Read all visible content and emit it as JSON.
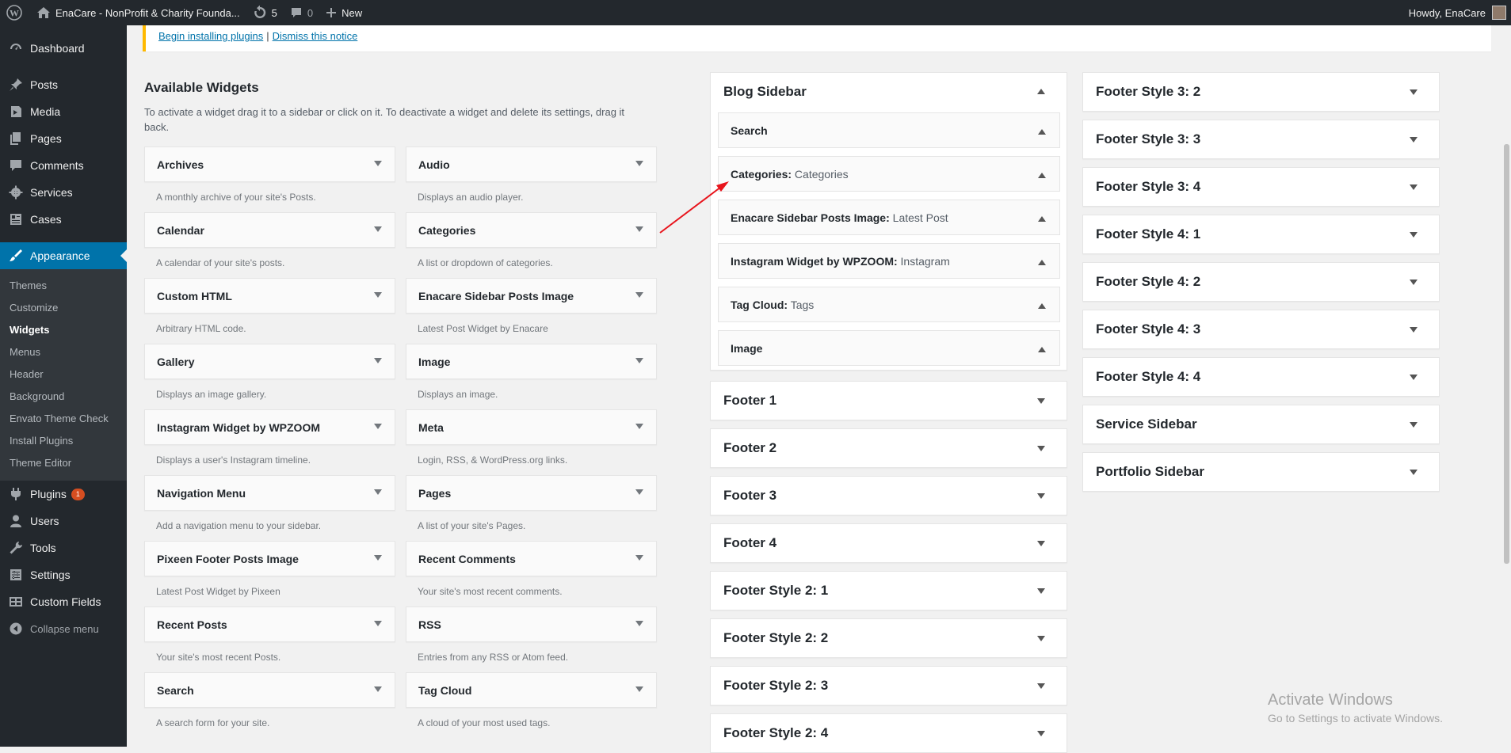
{
  "adminbar": {
    "site_name": "EnaCare - NonProfit & Charity Founda...",
    "updates_count": "5",
    "comments_count": "0",
    "new_label": "New",
    "howdy": "Howdy, EnaCare"
  },
  "menu": {
    "dashboard": "Dashboard",
    "posts": "Posts",
    "media": "Media",
    "pages": "Pages",
    "comments": "Comments",
    "services": "Services",
    "cases": "Cases",
    "appearance": "Appearance",
    "appearance_sub": [
      "Themes",
      "Customize",
      "Widgets",
      "Menus",
      "Header",
      "Background",
      "Envato Theme Check",
      "Install Plugins",
      "Theme Editor"
    ],
    "plugins": "Plugins",
    "plugins_badge": "1",
    "users": "Users",
    "tools": "Tools",
    "settings": "Settings",
    "custom_fields": "Custom Fields",
    "collapse": "Collapse menu"
  },
  "notice": {
    "begin_link": "Begin installing plugins",
    "separator": "|",
    "dismiss_link": "Dismiss this notice"
  },
  "available": {
    "title": "Available Widgets",
    "description": "To activate a widget drag it to a sidebar or click on it. To deactivate a widget and delete its settings, drag it back.",
    "widgets": [
      {
        "title": "Archives",
        "desc": "A monthly archive of your site's Posts."
      },
      {
        "title": "Audio",
        "desc": "Displays an audio player."
      },
      {
        "title": "Calendar",
        "desc": "A calendar of your site's posts."
      },
      {
        "title": "Categories",
        "desc": "A list or dropdown of categories."
      },
      {
        "title": "Custom HTML",
        "desc": "Arbitrary HTML code."
      },
      {
        "title": "Enacare Sidebar Posts Image",
        "desc": "Latest Post Widget by Enacare"
      },
      {
        "title": "Gallery",
        "desc": "Displays an image gallery."
      },
      {
        "title": "Image",
        "desc": "Displays an image."
      },
      {
        "title": "Instagram Widget by WPZOOM",
        "desc": "Displays a user's Instagram timeline."
      },
      {
        "title": "Meta",
        "desc": "Login, RSS, & WordPress.org links."
      },
      {
        "title": "Navigation Menu",
        "desc": "Add a navigation menu to your sidebar."
      },
      {
        "title": "Pages",
        "desc": "A list of your site's Pages."
      },
      {
        "title": "Pixeen Footer Posts Image",
        "desc": "Latest Post Widget by Pixeen"
      },
      {
        "title": "Recent Comments",
        "desc": "Your site's most recent comments."
      },
      {
        "title": "Recent Posts",
        "desc": "Your site's most recent Posts."
      },
      {
        "title": "RSS",
        "desc": "Entries from any RSS or Atom feed."
      },
      {
        "title": "Search",
        "desc": "A search form for your site."
      },
      {
        "title": "Tag Cloud",
        "desc": "A cloud of your most used tags."
      }
    ]
  },
  "blog_sidebar": {
    "title": "Blog Sidebar",
    "widgets": [
      {
        "title": "Search",
        "sub": ""
      },
      {
        "title": "Categories:",
        "sub": " Categories"
      },
      {
        "title": "Enacare Sidebar Posts Image:",
        "sub": " Latest Post"
      },
      {
        "title": "Instagram Widget by WPZOOM:",
        "sub": " Instagram"
      },
      {
        "title": "Tag Cloud:",
        "sub": " Tags"
      },
      {
        "title": "Image",
        "sub": ""
      }
    ]
  },
  "sidebars_col1": [
    "Footer 1",
    "Footer 2",
    "Footer 3",
    "Footer 4",
    "Footer Style 2: 1",
    "Footer Style 2: 2",
    "Footer Style 2: 3",
    "Footer Style 2: 4"
  ],
  "sidebars_col2": [
    "Footer Style 3: 2",
    "Footer Style 3: 3",
    "Footer Style 3: 4",
    "Footer Style 4: 1",
    "Footer Style 4: 2",
    "Footer Style 4: 3",
    "Footer Style 4: 4",
    "Service Sidebar",
    "Portfolio Sidebar"
  ],
  "watermark": {
    "line1": "Activate Windows",
    "line2": "Go to Settings to activate Windows."
  },
  "colors": {
    "accent": "#0073aa",
    "annotation_arrow": "#e8141c",
    "notice_border": "#ffb900"
  }
}
